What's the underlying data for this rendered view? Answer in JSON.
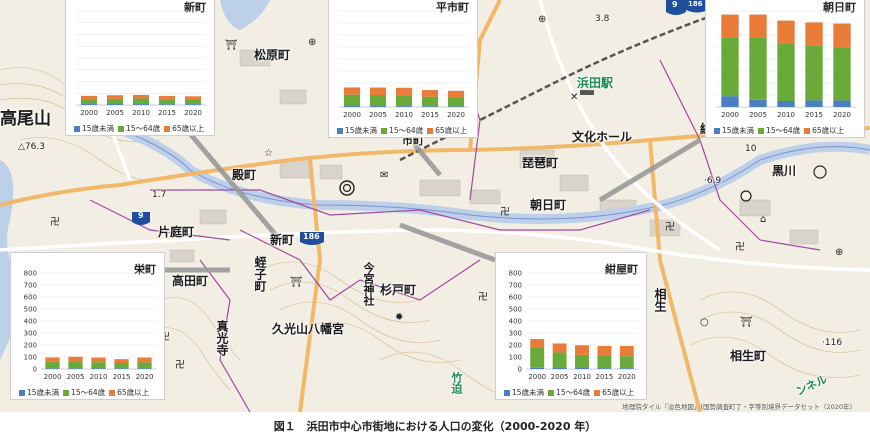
{
  "caption": "図１　浜田市中心市街地における人口の変化（2000-2020 年）",
  "credit": "地理院タイル「淡色地図」(国勢調査町丁・字等別境界データセット（2020年）",
  "colors": {
    "under15": "#4a7fc1",
    "age15_64": "#6aaa3a",
    "over65": "#ea7c3a"
  },
  "legend": {
    "under15": "15歳未満",
    "age15_64": "15～64歳",
    "over65": "65歳以上"
  },
  "map_labels": {
    "takaoyama": "高尾山",
    "matsubaracho": "松原町",
    "tonomachi": "殿町",
    "katabacho": "片庭町",
    "shinmachi": "新町",
    "takadacho": "高田町",
    "ebisucho": "蛭子町",
    "shinkoji": "真光寺",
    "kumitsu": "久光山八幡宮",
    "imamiya": "今宮神社",
    "sugitocho": "杉戸町",
    "biwacho": "琵琶町",
    "asahimachi": "朝日町",
    "bunka": "文化ホール",
    "hamada_eki": "浜田駅",
    "kurokawa": "黒川",
    "aioicho": "相生町",
    "aio": "相生",
    "chikuu": "竹迫",
    "tunnel": "ンネル",
    "sogo": "総",
    "ichimachi": "市町",
    "elev1": "△76.3",
    "elev2": "·116",
    "elev3": "·6.9",
    "elev4": "3.8",
    "elev5": "1.7",
    "n10": "10",
    "route9a": "9",
    "route9b": "9",
    "route186a": "186",
    "route186b": "186"
  },
  "chart_data": [
    {
      "type": "bar",
      "title": "新町",
      "categories": [
        "2000",
        "2005",
        "2010",
        "2015",
        "2020"
      ],
      "ylim": [
        0,
        800
      ],
      "yticks": [],
      "series": [
        {
          "name": "15歳未満",
          "values": [
            8,
            8,
            8,
            7,
            7
          ]
        },
        {
          "name": "15～64歳",
          "values": [
            42,
            45,
            48,
            42,
            40
          ]
        },
        {
          "name": "65歳以上",
          "values": [
            28,
            30,
            30,
            28,
            27
          ]
        }
      ]
    },
    {
      "type": "bar",
      "title": "平市町",
      "categories": [
        "2000",
        "2005",
        "2010",
        "2015",
        "2020"
      ],
      "ylim": [
        0,
        800
      ],
      "yticks": [],
      "series": [
        {
          "name": "15歳未満",
          "values": [
            8,
            8,
            7,
            6,
            5
          ]
        },
        {
          "name": "15～64歳",
          "values": [
            95,
            92,
            88,
            80,
            75
          ]
        },
        {
          "name": "65歳以上",
          "values": [
            60,
            62,
            65,
            55,
            55
          ]
        }
      ]
    },
    {
      "type": "bar",
      "title": "朝日町",
      "categories": [
        "2000",
        "2005",
        "2010",
        "2015",
        "2020"
      ],
      "ylim": [
        0,
        800
      ],
      "yticks": [],
      "series": [
        {
          "name": "15歳未満",
          "values": [
            90,
            60,
            50,
            55,
            55
          ]
        },
        {
          "name": "15～64歳",
          "values": [
            490,
            520,
            480,
            460,
            440
          ]
        },
        {
          "name": "65歳以上",
          "values": [
            190,
            190,
            190,
            190,
            200
          ]
        }
      ]
    },
    {
      "type": "bar",
      "title": "栄町",
      "categories": [
        "2000",
        "2005",
        "2010",
        "2015",
        "2020"
      ],
      "ylim": [
        0,
        800
      ],
      "yticks": [
        "0",
        "100",
        "200",
        "300",
        "400",
        "500",
        "600",
        "700",
        "800"
      ],
      "series": [
        {
          "name": "15歳未満",
          "values": [
            6,
            6,
            5,
            5,
            5
          ]
        },
        {
          "name": "15～64歳",
          "values": [
            55,
            58,
            52,
            45,
            50
          ]
        },
        {
          "name": "65歳以上",
          "values": [
            35,
            38,
            38,
            32,
            40
          ]
        }
      ]
    },
    {
      "type": "bar",
      "title": "紺屋町",
      "categories": [
        "2000",
        "2005",
        "2010",
        "2015",
        "2020"
      ],
      "ylim": [
        0,
        800
      ],
      "yticks": [
        "0",
        "100",
        "200",
        "300",
        "400",
        "500",
        "600",
        "700",
        "800"
      ],
      "series": [
        {
          "name": "15歳未満",
          "values": [
            10,
            8,
            8,
            7,
            7
          ]
        },
        {
          "name": "15～64歳",
          "values": [
            165,
            130,
            110,
            105,
            100
          ]
        },
        {
          "name": "65歳以上",
          "values": [
            75,
            75,
            80,
            80,
            85
          ]
        }
      ]
    }
  ]
}
